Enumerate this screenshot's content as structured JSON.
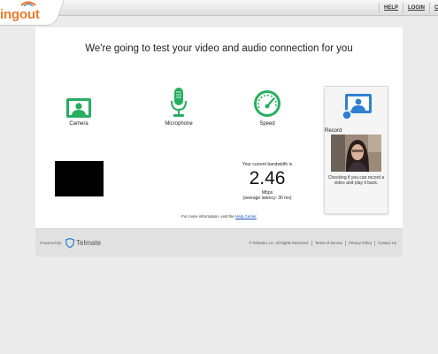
{
  "header": {
    "logo_text": "ingout",
    "links": [
      "HELP",
      "LOGIN",
      "C"
    ]
  },
  "main": {
    "heading": "We're going to test your video and audio connection for you",
    "camera": {
      "title": "Camera",
      "icon": "camera-icon"
    },
    "microphone": {
      "title": "Microphone",
      "icon": "microphone-icon"
    },
    "speed": {
      "title": "Speed",
      "icon": "speedometer-icon",
      "label": "Your current bandwidth is",
      "value": "2.46",
      "unit": "Mbps",
      "latency": "(average latency: 30 ms)"
    },
    "record": {
      "title": "Record",
      "icon": "record-icon",
      "note": "Checking if you can record a video and play it back."
    },
    "info_prefix": "For more information, visit the ",
    "info_link": "Help Center"
  },
  "footer": {
    "powered_by": "Powered By:",
    "brand": "Telmate",
    "copyright": "© Telmate LLC. All Rights Reserved.",
    "terms": "Terms of Service",
    "privacy": "Privacy Policy",
    "contact": "Contact Us"
  },
  "colors": {
    "accent_green": "#27ae60",
    "record_blue": "#2f80d0",
    "logo_orange": "#f07a2c"
  }
}
